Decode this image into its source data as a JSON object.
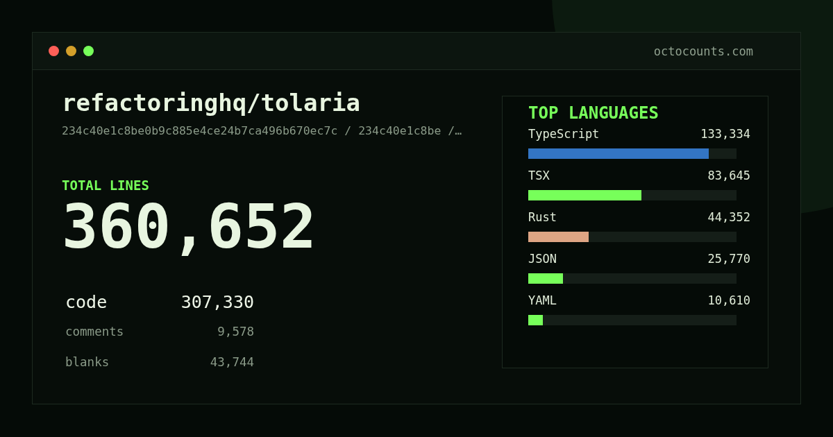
{
  "window": {
    "controls": [
      {
        "color": "#ff5f57"
      },
      {
        "color": "#d4a02a"
      },
      {
        "color": "#77ff5a"
      }
    ],
    "domain": "octocounts.com"
  },
  "repo": {
    "name": "refactoringhq/tolaria",
    "ref": "234c40e1c8be0b9c885e4ce24b7ca496b670ec7c / 234c40e1c8be /…"
  },
  "total": {
    "label": "TOTAL LINES",
    "value": "360,652"
  },
  "stats": [
    {
      "kind": "primary",
      "label": "code",
      "value": "307,330"
    },
    {
      "kind": "secondary",
      "label": "comments",
      "value": "9,578"
    },
    {
      "kind": "secondary",
      "label": "blanks",
      "value": "43,744"
    }
  ],
  "languages": {
    "title": "TOP LANGUAGES",
    "items": [
      {
        "name": "TypeScript",
        "value": "133,334",
        "level": 0.867,
        "color": "#3375c4"
      },
      {
        "name": "TSX",
        "value": "83,645",
        "level": 0.543,
        "color": "#77ff5a"
      },
      {
        "name": "Rust",
        "value": "44,352",
        "level": 0.29,
        "color": "#dea584"
      },
      {
        "name": "JSON",
        "value": "25,770",
        "level": 0.167,
        "color": "#77ff5a"
      },
      {
        "name": "YAML",
        "value": "10,610",
        "level": 0.07,
        "color": "#77ff5a"
      }
    ]
  }
}
